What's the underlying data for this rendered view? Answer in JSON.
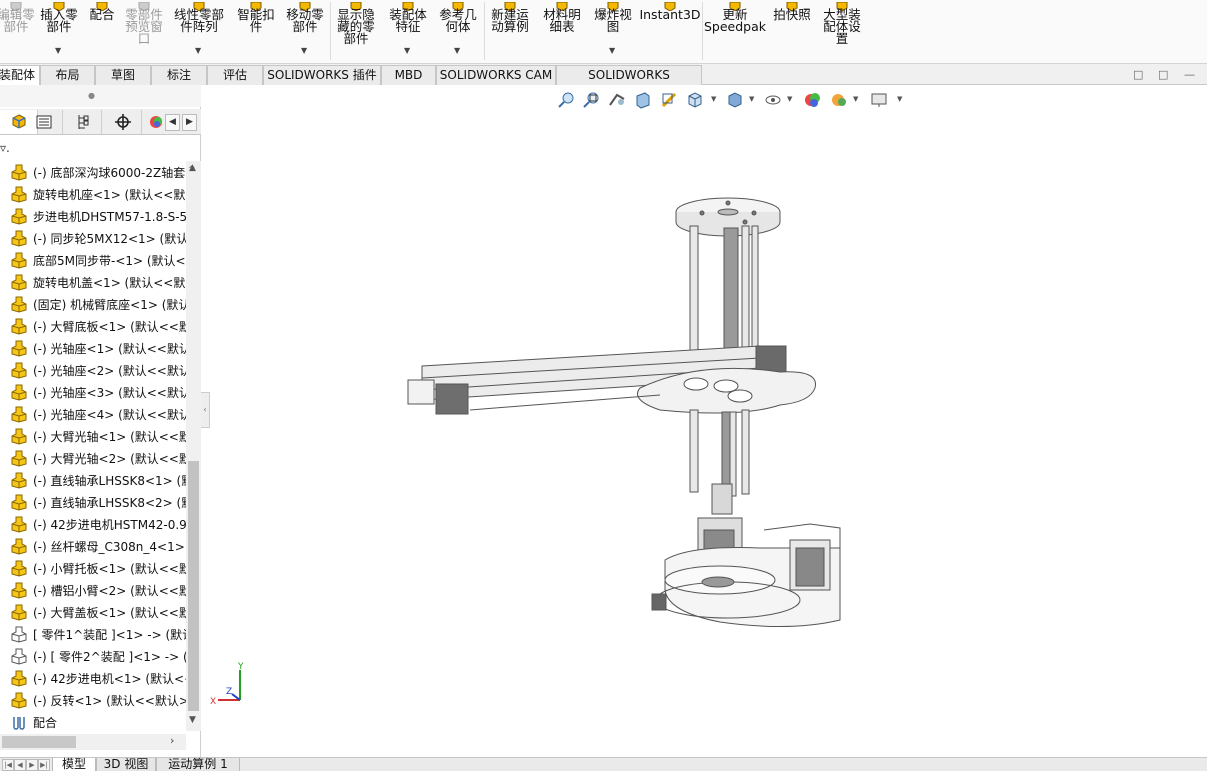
{
  "ribbon": {
    "buttons": [
      {
        "label": "编辑零\n部件",
        "disabled": true
      },
      {
        "label": "插入零\n部件"
      },
      {
        "label": "配合"
      },
      {
        "label": "零部件\n预览窗\n口",
        "disabled": true
      },
      {
        "label": "线性零部\n件阵列"
      },
      {
        "label": "智能扣\n件"
      },
      {
        "label": "移动零\n部件"
      },
      {
        "label": "显示隐\n藏的零\n部件"
      },
      {
        "label": "装配体\n特征"
      },
      {
        "label": "参考几\n何体"
      },
      {
        "label": "新建运\n动算例"
      },
      {
        "label": "材料明\n细表"
      },
      {
        "label": "爆炸视\n图"
      },
      {
        "label": "Instant3D"
      },
      {
        "label": "更新\nSpeedpak"
      },
      {
        "label": "拍快照"
      },
      {
        "label": "大型装\n配体设\n置"
      }
    ]
  },
  "tabs": [
    {
      "label": "装配体",
      "active": true
    },
    {
      "label": "布局"
    },
    {
      "label": "草图"
    },
    {
      "label": "标注"
    },
    {
      "label": "评估"
    },
    {
      "label": "SOLIDWORKS 插件"
    },
    {
      "label": "MBD"
    },
    {
      "label": "SOLIDWORKS CAM"
    },
    {
      "label": "SOLIDWORKS Inspection"
    }
  ],
  "tree": {
    "items": [
      {
        "label": "(-) 底部深沟球6000-2Z轴套",
        "icon": "assembly-icon"
      },
      {
        "label": "旋转电机座<1> (默认<<默认",
        "icon": "assembly-icon"
      },
      {
        "label": "步进电机DHSTM57-1.8-S-5",
        "icon": "assembly-icon"
      },
      {
        "label": "(-) 同步轮5MX12<1> (默认",
        "icon": "assembly-icon"
      },
      {
        "label": "底部5M同步带-<1> (默认<",
        "icon": "assembly-icon"
      },
      {
        "label": "旋转电机盖<1> (默认<<默认",
        "icon": "assembly-icon"
      },
      {
        "label": "(固定) 机械臂底座<1> (默认",
        "icon": "assembly-icon"
      },
      {
        "label": "(-) 大臂底板<1> (默认<<默",
        "icon": "assembly-icon"
      },
      {
        "label": "(-) 光轴座<1> (默认<<默认",
        "icon": "assembly-icon"
      },
      {
        "label": "(-) 光轴座<2> (默认<<默认",
        "icon": "assembly-icon"
      },
      {
        "label": "(-) 光轴座<3> (默认<<默认",
        "icon": "assembly-icon"
      },
      {
        "label": "(-) 光轴座<4> (默认<<默认",
        "icon": "assembly-icon"
      },
      {
        "label": "(-) 大臂光轴<1> (默认<<默",
        "icon": "assembly-icon"
      },
      {
        "label": "(-) 大臂光轴<2> (默认<<默",
        "icon": "assembly-icon"
      },
      {
        "label": "(-) 直线轴承LHSSK8<1> (默",
        "icon": "assembly-icon"
      },
      {
        "label": "(-) 直线轴承LHSSK8<2> (默",
        "icon": "assembly-icon"
      },
      {
        "label": "(-) 42步进电机HSTM42-0.9",
        "icon": "assembly-icon"
      },
      {
        "label": "(-) 丝杆螺母_C308n_4<1> (",
        "icon": "assembly-icon"
      },
      {
        "label": "(-) 小臂托板<1> (默认<<默",
        "icon": "assembly-icon"
      },
      {
        "label": "(-) 槽铝小臂<2> (默认<<默",
        "icon": "assembly-icon"
      },
      {
        "label": "(-) 大臂盖板<1> (默认<<默",
        "icon": "assembly-icon"
      },
      {
        "label": "[ 零件1^装配 ]<1> -> (默认",
        "icon": "virtual-part-icon"
      },
      {
        "label": "(-) [ 零件2^装配 ]<1> -> (",
        "icon": "virtual-part-icon"
      },
      {
        "label": "(-) 42步进电机<1> (默认<<",
        "icon": "assembly-icon"
      },
      {
        "label": "(-) 反转<1> (默认<<默认>",
        "icon": "assembly-icon"
      },
      {
        "label": "配合",
        "icon": "mates-icon"
      }
    ]
  },
  "bottom_tabs": [
    {
      "label": "模型",
      "active": true
    },
    {
      "label": "3D 视图"
    },
    {
      "label": "运动算例 1"
    }
  ],
  "triad": {
    "x": "X",
    "y": "Y",
    "z": "Z"
  },
  "colors": {
    "accent": "#f5b800",
    "tabActive": "#ffffff",
    "triadX": "#d03030",
    "triadY": "#20a020",
    "triadZ": "#2040c0"
  }
}
